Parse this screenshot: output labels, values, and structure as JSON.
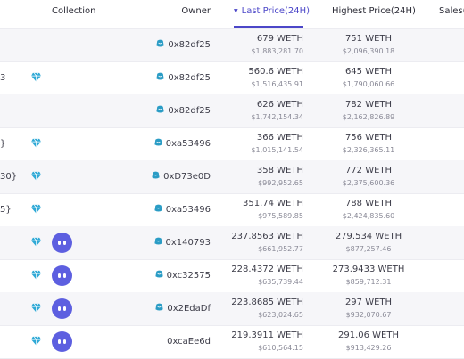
{
  "header": {
    "collection": "Collection",
    "owner": "Owner",
    "last_price": "Last Price(24H)",
    "highest_price": "Highest Price(24H)",
    "sales": "Sales("
  },
  "colors": {
    "accent": "#4b46c8",
    "diamond": "#2fa9d6",
    "avatar": "#5d5fe0",
    "owner_icon": "#2a9cc5"
  },
  "icons": {
    "sort": "sort-desc-icon",
    "diamond": "diamond-icon",
    "owner": "owner-icon",
    "avatar": "avatar-icon"
  },
  "rows": [
    {
      "name_fragment": "",
      "diamond": false,
      "avatar": false,
      "owner_icon": true,
      "owner": "0x82df25",
      "last_weth": "679 WETH",
      "last_usd": "$1,883,281.70",
      "high_weth": "751 WETH",
      "high_usd": "$2,096,390.18"
    },
    {
      "name_fragment": "3",
      "diamond": true,
      "avatar": false,
      "owner_icon": true,
      "owner": "0x82df25",
      "last_weth": "560.6 WETH",
      "last_usd": "$1,516,435.91",
      "high_weth": "645 WETH",
      "high_usd": "$1,790,060.66"
    },
    {
      "name_fragment": "",
      "diamond": false,
      "avatar": false,
      "owner_icon": true,
      "owner": "0x82df25",
      "last_weth": "626 WETH",
      "last_usd": "$1,742,154.34",
      "high_weth": "782 WETH",
      "high_usd": "$2,162,826.89"
    },
    {
      "name_fragment": "}",
      "diamond": true,
      "avatar": false,
      "owner_icon": true,
      "owner": "0xa53496",
      "last_weth": "366 WETH",
      "last_usd": "$1,015,141.54",
      "high_weth": "756 WETH",
      "high_usd": "$2,326,365.11"
    },
    {
      "name_fragment": "30}",
      "diamond": true,
      "avatar": false,
      "owner_icon": true,
      "owner": "0xD73e0D",
      "last_weth": "358 WETH",
      "last_usd": "$992,952.65",
      "high_weth": "772 WETH",
      "high_usd": "$2,375,600.36"
    },
    {
      "name_fragment": "5}",
      "diamond": true,
      "avatar": false,
      "owner_icon": true,
      "owner": "0xa53496",
      "last_weth": "351.74 WETH",
      "last_usd": "$975,589.85",
      "high_weth": "788 WETH",
      "high_usd": "$2,424,835.60"
    },
    {
      "name_fragment": "",
      "diamond": true,
      "avatar": true,
      "owner_icon": true,
      "owner": "0x140793",
      "last_weth": "237.8563 WETH",
      "last_usd": "$661,952.77",
      "high_weth": "279.534 WETH",
      "high_usd": "$877,257.46"
    },
    {
      "name_fragment": "",
      "diamond": true,
      "avatar": true,
      "owner_icon": true,
      "owner": "0xc32575",
      "last_weth": "228.4372 WETH",
      "last_usd": "$635,739.44",
      "high_weth": "273.9433 WETH",
      "high_usd": "$859,712.31"
    },
    {
      "name_fragment": "",
      "diamond": true,
      "avatar": true,
      "owner_icon": true,
      "owner": "0x2EdaDf",
      "last_weth": "223.8685 WETH",
      "last_usd": "$623,024.65",
      "high_weth": "297 WETH",
      "high_usd": "$932,070.67"
    },
    {
      "name_fragment": "",
      "diamond": true,
      "avatar": true,
      "owner_icon": false,
      "owner": "0xcaEe6d",
      "last_weth": "219.3911 WETH",
      "last_usd": "$610,564.15",
      "high_weth": "291.06 WETH",
      "high_usd": "$913,429.26"
    }
  ]
}
